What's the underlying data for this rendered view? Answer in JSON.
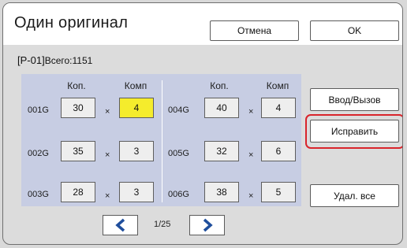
{
  "header": {
    "title": "Один оригинал",
    "cancel_label": "Отмена",
    "ok_label": "OK"
  },
  "info": {
    "program": "[P-01]",
    "total": "Всего:1151"
  },
  "columns": {
    "copies": "Коп.",
    "sets": "Комп"
  },
  "rows": [
    {
      "label": "001G",
      "copies": "30",
      "sets": "4"
    },
    {
      "label": "002G",
      "copies": "35",
      "sets": "3"
    },
    {
      "label": "003G",
      "copies": "28",
      "sets": "3"
    },
    {
      "label": "004G",
      "copies": "40",
      "sets": "4"
    },
    {
      "label": "005G",
      "copies": "32",
      "sets": "6"
    },
    {
      "label": "006G",
      "copies": "38",
      "sets": "5"
    }
  ],
  "mult_sign": "×",
  "side": {
    "enter_recall": "Ввод/Вызов",
    "edit": "Исправить",
    "delete_all": "Удал. все"
  },
  "pager": {
    "page": "1/25",
    "prev_icon": "chevron-left-icon",
    "next_icon": "chevron-right-icon"
  },
  "colors": {
    "accent": "#1f4e9c",
    "highlight": "#d9242b",
    "active_cell": "#f5ec2c",
    "panel": "#c7cde3"
  }
}
